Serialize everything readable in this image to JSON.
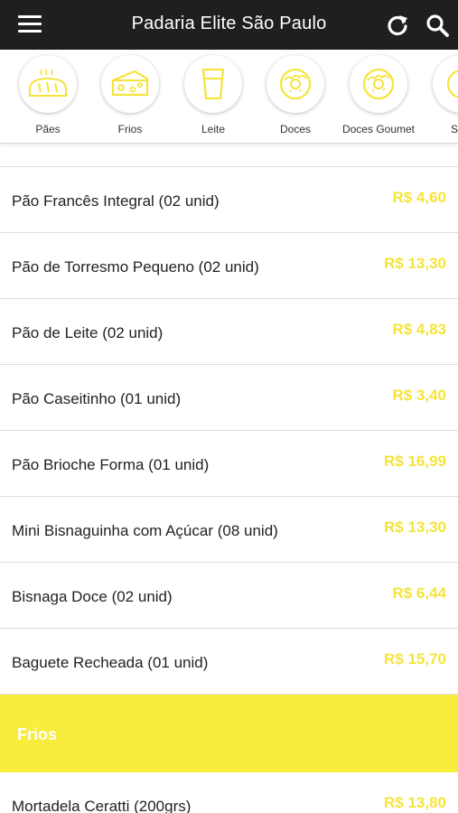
{
  "header": {
    "title": "Padaria Elite São Paulo"
  },
  "colors": {
    "topbar": "#1f1f1f",
    "accent": "#f8ec3c",
    "price": "#f5e43a"
  },
  "categories": [
    {
      "label": "Pães",
      "icon": "bread-icon"
    },
    {
      "label": "Frios",
      "icon": "cheese-icon"
    },
    {
      "label": "Leite",
      "icon": "milk-glass-icon"
    },
    {
      "label": "Doces",
      "icon": "donut-icon"
    },
    {
      "label": "Doces Goumet",
      "icon": "donut-icon"
    },
    {
      "label": "Salg",
      "icon": "snack-icon"
    }
  ],
  "products": [
    {
      "name": "Pão Francês Integral (02 unid)",
      "price": "R$ 4,60"
    },
    {
      "name": "Pão de Torresmo Pequeno (02 unid)",
      "price": "R$ 13,30"
    },
    {
      "name": "Pão de Leite (02 unid)",
      "price": "R$ 4,83"
    },
    {
      "name": "Pão Caseitinho (01 unid)",
      "price": "R$ 3,40"
    },
    {
      "name": "Pão Brioche Forma (01 unid)",
      "price": "R$ 16,99"
    },
    {
      "name": "Mini Bisnaguinha com Açúcar (08 unid)",
      "price": "R$ 13,30"
    },
    {
      "name": "Bisnaga Doce (02 unid)",
      "price": "R$ 6,44"
    },
    {
      "name": "Baguete Recheada (01 unid)",
      "price": "R$ 15,70"
    }
  ],
  "section_frios": {
    "title": "Frios",
    "products": [
      {
        "name": "Mortadela Ceratti (200grs)",
        "price": "R$ 13,80"
      }
    ]
  }
}
